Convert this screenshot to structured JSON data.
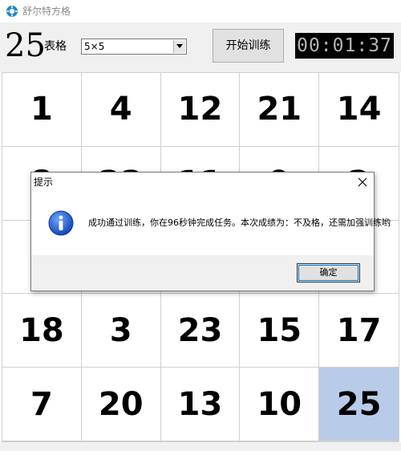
{
  "window": {
    "title": "舒尔特方格",
    "app_icon": "gear-icon"
  },
  "toolbar": {
    "count": "25",
    "grid_label": "表格",
    "size_select": {
      "value": "5×5"
    },
    "start_label": "开始训练",
    "timer": "00:01:37"
  },
  "board": {
    "cells": [
      "1",
      "4",
      "12",
      "21",
      "14",
      "8",
      "22",
      "11",
      "9",
      "2",
      "",
      "",
      "",
      "",
      "",
      "18",
      "3",
      "23",
      "15",
      "17",
      "7",
      "20",
      "13",
      "10",
      "25"
    ],
    "completed_cell": "25",
    "completed_color": "#b8cce8"
  },
  "dialog": {
    "title": "提示",
    "icon": "info-icon",
    "message": "成功通过训练，你在96秒钟完成任务。本次成绩为：不及格，还需加强训练哟",
    "ok_label": "确定"
  }
}
